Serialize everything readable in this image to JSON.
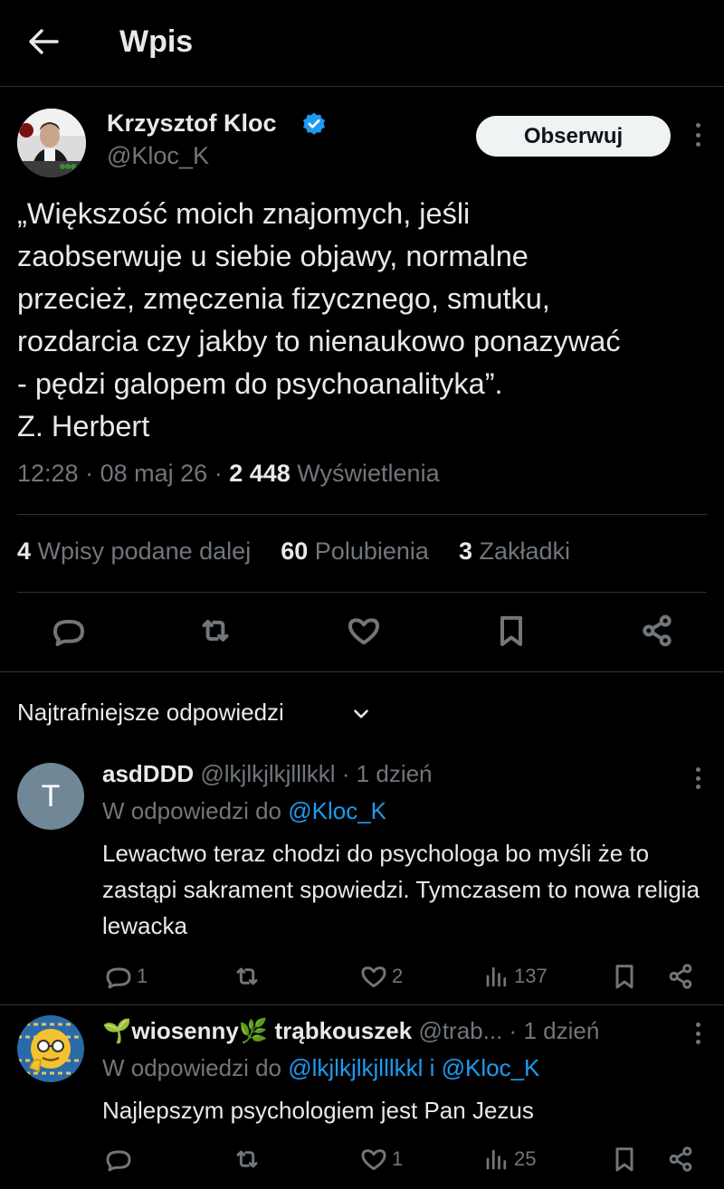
{
  "header": {
    "title": "Wpis"
  },
  "tweet": {
    "author_name": "Krzysztof Kloc",
    "author_handle": "@Kloc_K",
    "follow_label": "Obserwuj",
    "text": "„Większość moich znajomych, jeśli\nzaobserwuje u siebie objawy, normalne\nprzecież, zmęczenia fizycznego, smutku,\nrozdarcia czy jakby to nienaukowo ponazywać\n- pędzi galopem do psychoanalityka”.\nZ. Herbert",
    "time": "12:28",
    "date": "08 maj 26",
    "views": "2 448",
    "views_label": "Wyświetlenia",
    "stats": {
      "reposts": "4",
      "reposts_label": "Wpisy podane dalej",
      "likes": "60",
      "likes_label": "Polubienia",
      "bookmarks": "3",
      "bookmarks_label": "Zakładki"
    }
  },
  "sort": {
    "label": "Najtrafniejsze odpowiedzi"
  },
  "replies": [
    {
      "avatar_letter": "T",
      "name": "asdDDD",
      "handle": "@lkjlkjlkjlllkkl",
      "time": "1 dzień",
      "reply_to_prefix": "W odpowiedzi do",
      "reply_to": "@Kloc_K",
      "text": "Lewactwo teraz chodzi do psychologa bo myśli że to zastąpi sakrament spowiedzi. Tymczasem to nowa religia lewacka",
      "replies_count": "1",
      "likes_count": "2",
      "views_count": "137"
    },
    {
      "name_emoji_left": "🌱",
      "name": "wiosenny",
      "name_emoji_right": "🌿",
      "name_rest": "trąbkouszek",
      "handle": "@trab...",
      "time": "1 dzień",
      "reply_to_prefix": "W odpowiedzi do",
      "reply_to": "@lkjlkjlkjlllkkl i @Kloc_K",
      "text": "Najlepszym psychologiem jest Pan Jezus",
      "replies_count": "",
      "likes_count": "1",
      "views_count": "25"
    }
  ]
}
